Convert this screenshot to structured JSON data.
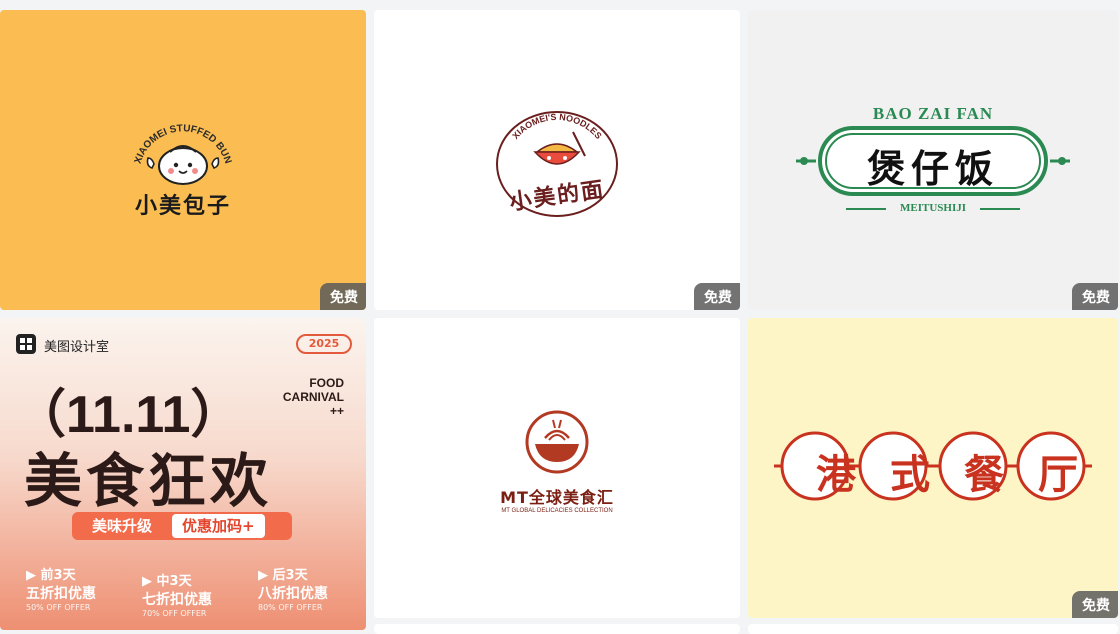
{
  "badge_label": "免费",
  "cards": {
    "bun": {
      "arc_text": "XIAOMEI STUFFED BUN",
      "title": "小美包子",
      "bg": "#fbbd52"
    },
    "noodles": {
      "arc_text": "XIAOMEI'S NOODLES",
      "title": "小美的面",
      "bg": "#ffffff"
    },
    "baozai": {
      "top": "BAO ZAI FAN",
      "title": "煲仔饭",
      "bottom": "MEITUSHIJI",
      "bg": "#f1f1f1",
      "accent": "#2a8a52"
    },
    "poster": {
      "brand": "美图设计室",
      "year": "2025",
      "date": "（11.11）",
      "carnival": [
        "FOOD",
        "CARNIVAL",
        "++"
      ],
      "main": "美食狂欢",
      "pill_left": "美味升级",
      "pill_right": "优惠加码+",
      "deals": [
        {
          "small": "前3天",
          "main": "五折扣优惠",
          "en": "50% OFF OFFER"
        },
        {
          "small": "中3天",
          "main": "七折扣优惠",
          "en": "70% OFF OFFER"
        },
        {
          "small": "后3天",
          "main": "八折扣优惠",
          "en": "80% OFF OFFER"
        }
      ]
    },
    "mt": {
      "title": "MT全球美食汇",
      "subtitle": "MT GLOBAL DELICACIES COLLECTION",
      "bg": "#ffffff",
      "accent": "#b33a22"
    },
    "hk": {
      "title": "港式餐厅",
      "bg": "#fdf5c6",
      "accent": "#c8321e"
    }
  }
}
